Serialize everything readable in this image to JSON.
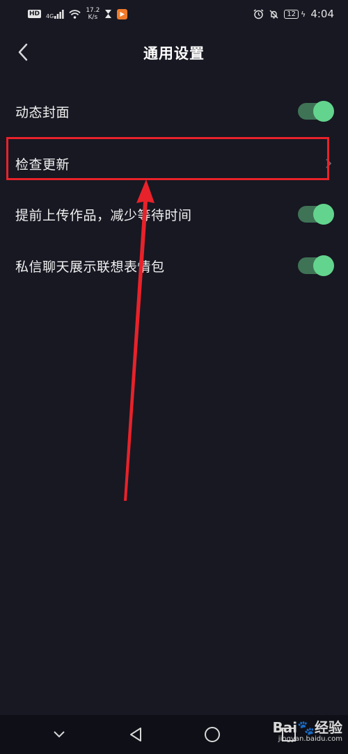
{
  "status_bar": {
    "hd": "HD",
    "network": "4G",
    "speed_value": "17.2",
    "speed_unit": "K/s",
    "battery": "12",
    "time": "4:04"
  },
  "header": {
    "title": "通用设置"
  },
  "settings": {
    "items": [
      {
        "label": "动态封面",
        "control": "toggle",
        "enabled": true
      },
      {
        "label": "检查更新",
        "control": "chevron"
      },
      {
        "label": "提前上传作品，减少等待时间",
        "control": "toggle",
        "enabled": true
      },
      {
        "label": "私信聊天展示联想表情包",
        "control": "toggle",
        "enabled": true
      }
    ]
  },
  "colors": {
    "background": "#171822",
    "toggle_track": "#3f7356",
    "toggle_knob": "#63d48d",
    "annotation": "#e8222a"
  },
  "icons": {
    "back": "chevron-left-icon",
    "nav_down": "chevron-down-icon",
    "nav_back": "triangle-back-icon",
    "nav_home": "circle-home-icon",
    "nav_recent": "square-recent-icon"
  },
  "watermark": {
    "brand": "Bai",
    "brand_suffix": "经验",
    "site": "jingyan.baidu.com"
  }
}
